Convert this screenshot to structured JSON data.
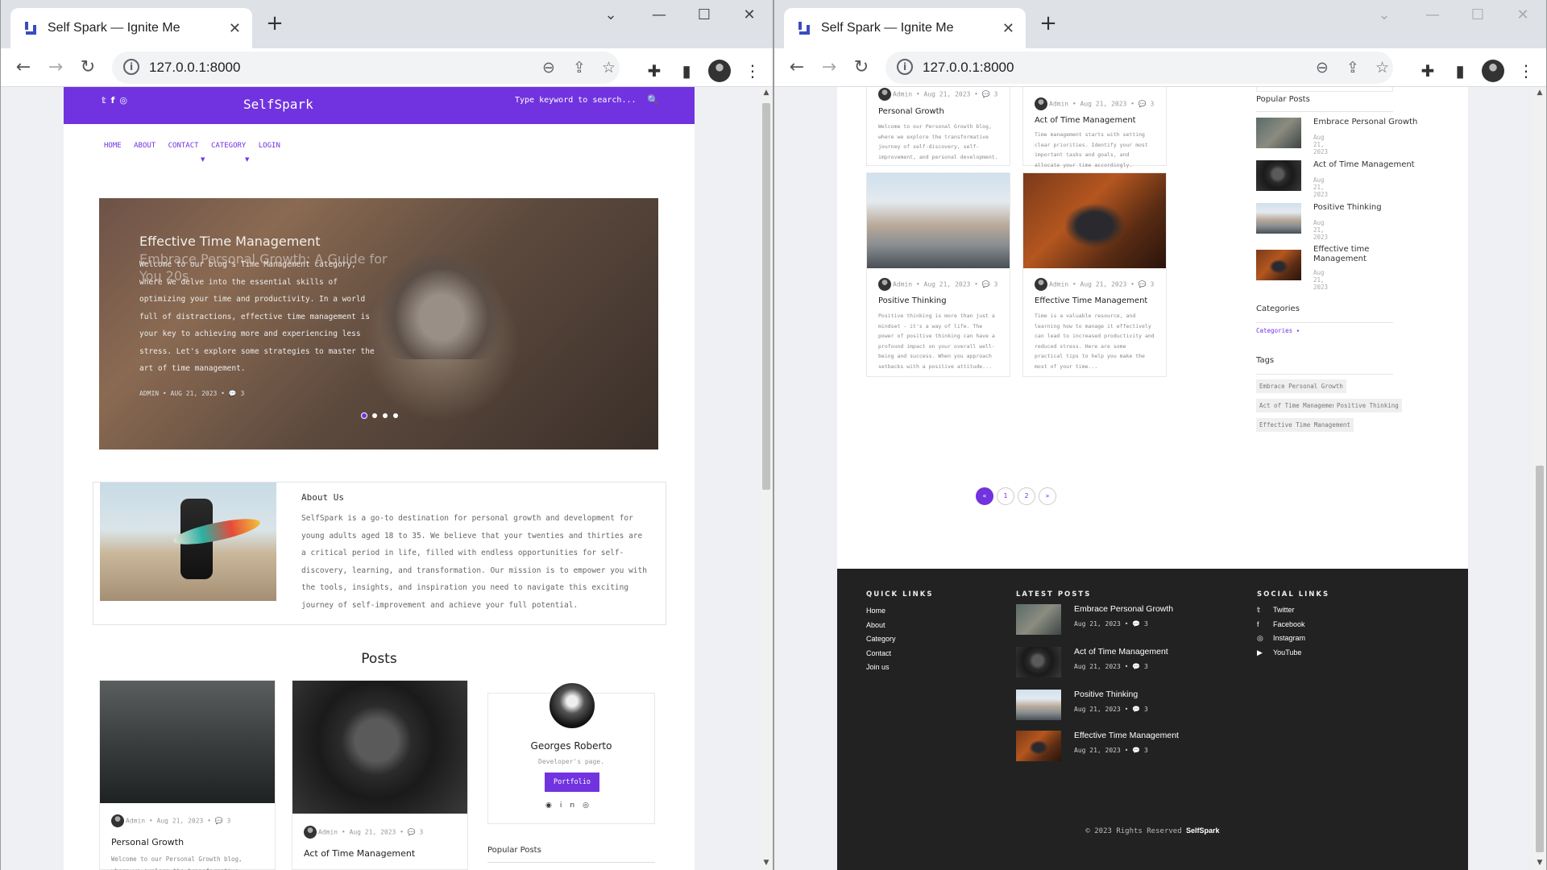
{
  "browser": {
    "tab_title": "Self Spark — Ignite Me",
    "new_tab": "+",
    "url": "127.0.0.1:8000"
  },
  "icons": [
    "favicon-icon",
    "close-icon",
    "minimize-icon",
    "maximize-icon",
    "chevron-down-icon",
    "back-icon",
    "forward-icon",
    "reload-icon",
    "info-icon",
    "zoom-out-icon",
    "share-icon",
    "star-icon",
    "extensions-icon",
    "sidebar-icon",
    "profile-avatar",
    "menu-icon",
    "twitter-icon",
    "facebook-icon",
    "instagram-icon",
    "search-icon",
    "github-icon",
    "linkedin-icon",
    "comment-icon",
    "youtube-icon"
  ],
  "site": {
    "brand": "SelfSpark",
    "search_placeholder": "Type keyword to search...",
    "nav": [
      "HOME",
      "ABOUT",
      "CONTACT",
      "CATEGORY",
      "LOGIN"
    ],
    "hero": {
      "title": "Effective Time Management",
      "ghost_title": "Embrace Personal Growth: A Guide for You 20s",
      "text": "Welcome to our blog's Time Management category, where we delve into the essential skills of optimizing your time and productivity. In a world full of distractions, effective time management is your key to achieving more and experiencing less stress. Let's explore some strategies to master the art of time management.",
      "meta": "ADMIN • AUG 21, 2023 • 💬 3",
      "slides": 4,
      "active_slide": 1
    },
    "about": {
      "title": "About Us",
      "text": "SelfSpark is a go-to destination for personal growth and development for young adults aged 18 to 35. We believe that your twenties and thirties are a critical period in life, filled with endless opportunities for self-discovery, learning, and transformation. Our mission is to empower you with the tools, insights, and inspiration you need to navigate this exciting journey of self-improvement and achieve your full potential."
    },
    "posts_heading": "Posts",
    "posts": [
      {
        "title": "Personal Growth",
        "meta": "Admin • Aug 21, 2023 • 💬 3",
        "excerpt": "Welcome to our Personal Growth blog, where we explore the transformative journey of self-discovery, self-improvement, and personal development."
      },
      {
        "title": "Act of Time Management",
        "meta": "Admin • Aug 21, 2023 • 💬 3",
        "excerpt": "Time management starts with setting clear priorities. Identify your most important tasks and goals, and allocate your time accordingly."
      },
      {
        "title": "Positive Thinking",
        "meta": "Admin • Aug 21, 2023 • 💬 3",
        "excerpt": "Positive thinking is more than just a mindset - it's a way of life. The power of positive thinking can have a profound impact on your overall well-being and success. When you approach setbacks with a positive attitude..."
      },
      {
        "title": "Effective Time Management",
        "meta": "Admin • Aug 21, 2023 • 💬 3",
        "excerpt": "Time is a valuable resource, and learning how to manage it effectively can lead to increased productivity and reduced stress. Here are some practical tips to help you make the most of your time..."
      }
    ],
    "author": {
      "name": "Georges Roberto",
      "role": "Developer's page.",
      "button": "Portfolio"
    },
    "popular_label": "Popular Posts",
    "popular": [
      {
        "title": "Embrace Personal Growth",
        "date": "Aug 21, 2023"
      },
      {
        "title": "Act of Time Management",
        "date": "Aug 21, 2023"
      },
      {
        "title": "Positive Thinking",
        "date": "Aug 21, 2023"
      },
      {
        "title": "Effective time Management",
        "date": "Aug 21, 2023"
      }
    ],
    "categories_label": "Categories",
    "categories_link": "Categories ▾",
    "tags_label": "Tags",
    "tags": [
      "Embrace Personal Growth",
      "Act of Time Management",
      "Positive Thinking",
      "Effective Time Management"
    ],
    "pagination": [
      "«",
      "1",
      "2",
      "»"
    ],
    "footer": {
      "quick_links_label": "QUICK LINKS",
      "quick_links": [
        "Home",
        "About",
        "Category",
        "Contact",
        "Join us"
      ],
      "latest_label": "LATEST POSTS",
      "latest": [
        {
          "title": "Embrace Personal Growth",
          "meta": "Aug 21, 2023 • 💬 3"
        },
        {
          "title": "Act of Time Management",
          "meta": "Aug 21, 2023 • 💬 3"
        },
        {
          "title": "Positive Thinking",
          "meta": "Aug 21, 2023 • 💬 3"
        },
        {
          "title": "Effective Time Management",
          "meta": "Aug 21, 2023 • 💬 3"
        }
      ],
      "social_label": "SOCIAL LINKS",
      "social": [
        "Twitter",
        "Facebook",
        "Instagram",
        "YouTube"
      ],
      "copyright": "© 2023 Rights Reserved",
      "copyright_brand": "SelfSpark"
    }
  },
  "colors": {
    "accent": "#7133e0",
    "footer": "#222222"
  }
}
